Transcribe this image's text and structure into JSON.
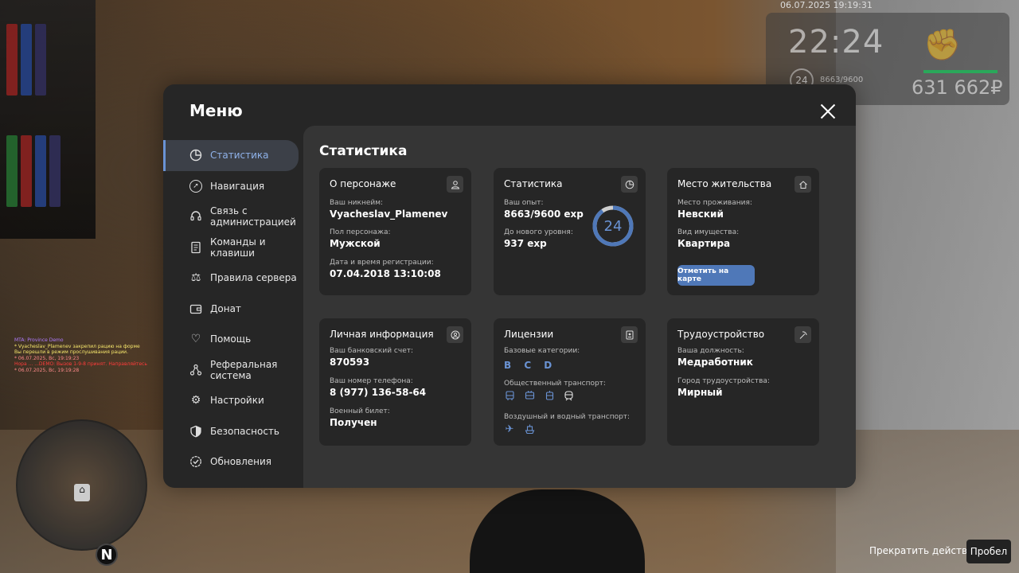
{
  "hud": {
    "datetime": "06.07.2025 19:19:31",
    "time": "22:24",
    "level": "24",
    "exp": "8663/9600",
    "money": "631 662₽"
  },
  "chat": [
    {
      "text": "MTA: Province Demo",
      "color": "#b07cff"
    },
    {
      "text": "* Vyacheslav_Plamenev закрепил рацию на форме",
      "color": "#f5e56b"
    },
    {
      "text": "Вы перешли в режим прослушивания рации.",
      "color": "#f5e56b"
    },
    {
      "text": "* 06.07.2025, Вс, 19:19:23",
      "color": "#ff8a8a"
    },
    {
      "text": "Нора ... ...DEMO: Вызов 1-9-8 принят. Направляйтесь",
      "color": "#ff3b3b"
    },
    {
      "text": "* 06.07.2025, Вс, 19:19:28",
      "color": "#ff8a8a"
    }
  ],
  "compass": "N",
  "bottom": {
    "action_label": "Прекратить действие",
    "key_label": "Пробел"
  },
  "menu": {
    "title": "Меню",
    "sidebar": [
      {
        "label": "Статистика",
        "icon": "pie-chart-icon",
        "active": true
      },
      {
        "label": "Навигация",
        "icon": "compass-icon"
      },
      {
        "label": "Связь с администрацией",
        "icon": "headset-icon"
      },
      {
        "label": "Команды и клавиши",
        "icon": "document-icon"
      },
      {
        "label": "Правила сервера",
        "icon": "scales-icon"
      },
      {
        "label": "Донат",
        "icon": "wallet-icon"
      },
      {
        "label": "Помощь",
        "icon": "handshake-heart-icon"
      },
      {
        "label": "Реферальная система",
        "icon": "network-icon"
      },
      {
        "label": "Настройки",
        "icon": "gear-icon"
      },
      {
        "label": "Безопасность",
        "icon": "shield-icon"
      },
      {
        "label": "Обновления",
        "icon": "check-badge-icon"
      }
    ],
    "content_title": "Статистика",
    "cards": {
      "character": {
        "title": "О персонаже",
        "nickname_label": "Ваш никнейм:",
        "nickname": "Vyacheslav_Plamenev",
        "gender_label": "Пол персонажа:",
        "gender": "Мужской",
        "reg_label": "Дата и время регистрации:",
        "reg": "07.04.2018 13:10:08"
      },
      "stats": {
        "title": "Статистика",
        "exp_label": "Ваш опыт:",
        "exp": "8663/9600 exp",
        "next_label": "До нового уровня:",
        "next": "937 exp",
        "level": "24",
        "progress": 0.9024
      },
      "residence": {
        "title": "Место жительства",
        "place_label": "Место проживания:",
        "place": "Невский",
        "property_label": "Вид имущества:",
        "property": "Квартира",
        "map_button": "Отметить на карте"
      },
      "personal": {
        "title": "Личная информация",
        "bank_label": "Ваш банковский счет:",
        "bank": "870593",
        "phone_label": "Ваш номер телефона:",
        "phone": "8 (977) 136-58-64",
        "military_label": "Военный билет:",
        "military": "Получен"
      },
      "licenses": {
        "title": "Лицензии",
        "base_label": "Базовые категории:",
        "base": "B C D",
        "public_label": "Общественный транспорт:",
        "air_label": "Воздушный и водный транспорт:"
      },
      "job": {
        "title": "Трудоустройство",
        "position_label": "Ваша должность:",
        "position": "Медработник",
        "city_label": "Город трудоустройства:",
        "city": "Мирный"
      }
    }
  },
  "colors": {
    "accent": "#6a93d4",
    "button": "#4f78b8",
    "panel": "#262626",
    "content": "#353535"
  }
}
